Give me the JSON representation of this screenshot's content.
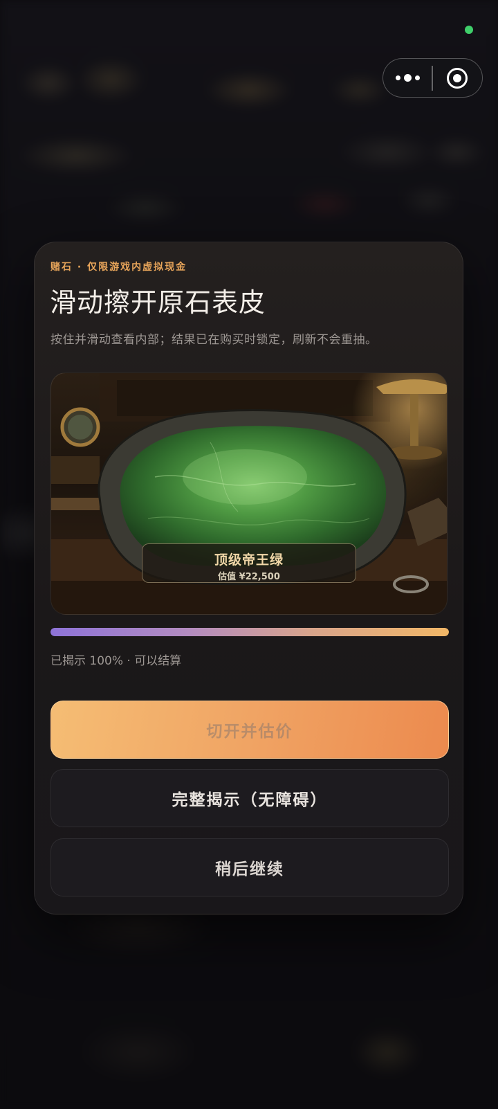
{
  "capsule": {
    "more_icon": "more-dots-icon",
    "close_icon": "target-close-icon"
  },
  "modal": {
    "eyebrow": "赌石 · 仅限游戏内虚拟现金",
    "title": "滑动擦开原石表皮",
    "description": "按住并滑动查看内部；结果已在购买时锁定，刷新不会重抽。",
    "result": {
      "name": "顶级帝王绿",
      "value": "估值 ¥22,500"
    },
    "progress": {
      "fraction": 1.0,
      "text": "已揭示 100% · 可以结算"
    },
    "buttons": {
      "primary": "切开并估价",
      "reveal": "完整揭示（无障碍）",
      "later": "稍后继续"
    }
  },
  "colors": {
    "accent": "#e8a55a",
    "primary_button_start": "#f5bd74",
    "primary_button_end": "#ec8a4e",
    "status_dot": "#3fcf6a",
    "jade": "#3f8a3a"
  }
}
